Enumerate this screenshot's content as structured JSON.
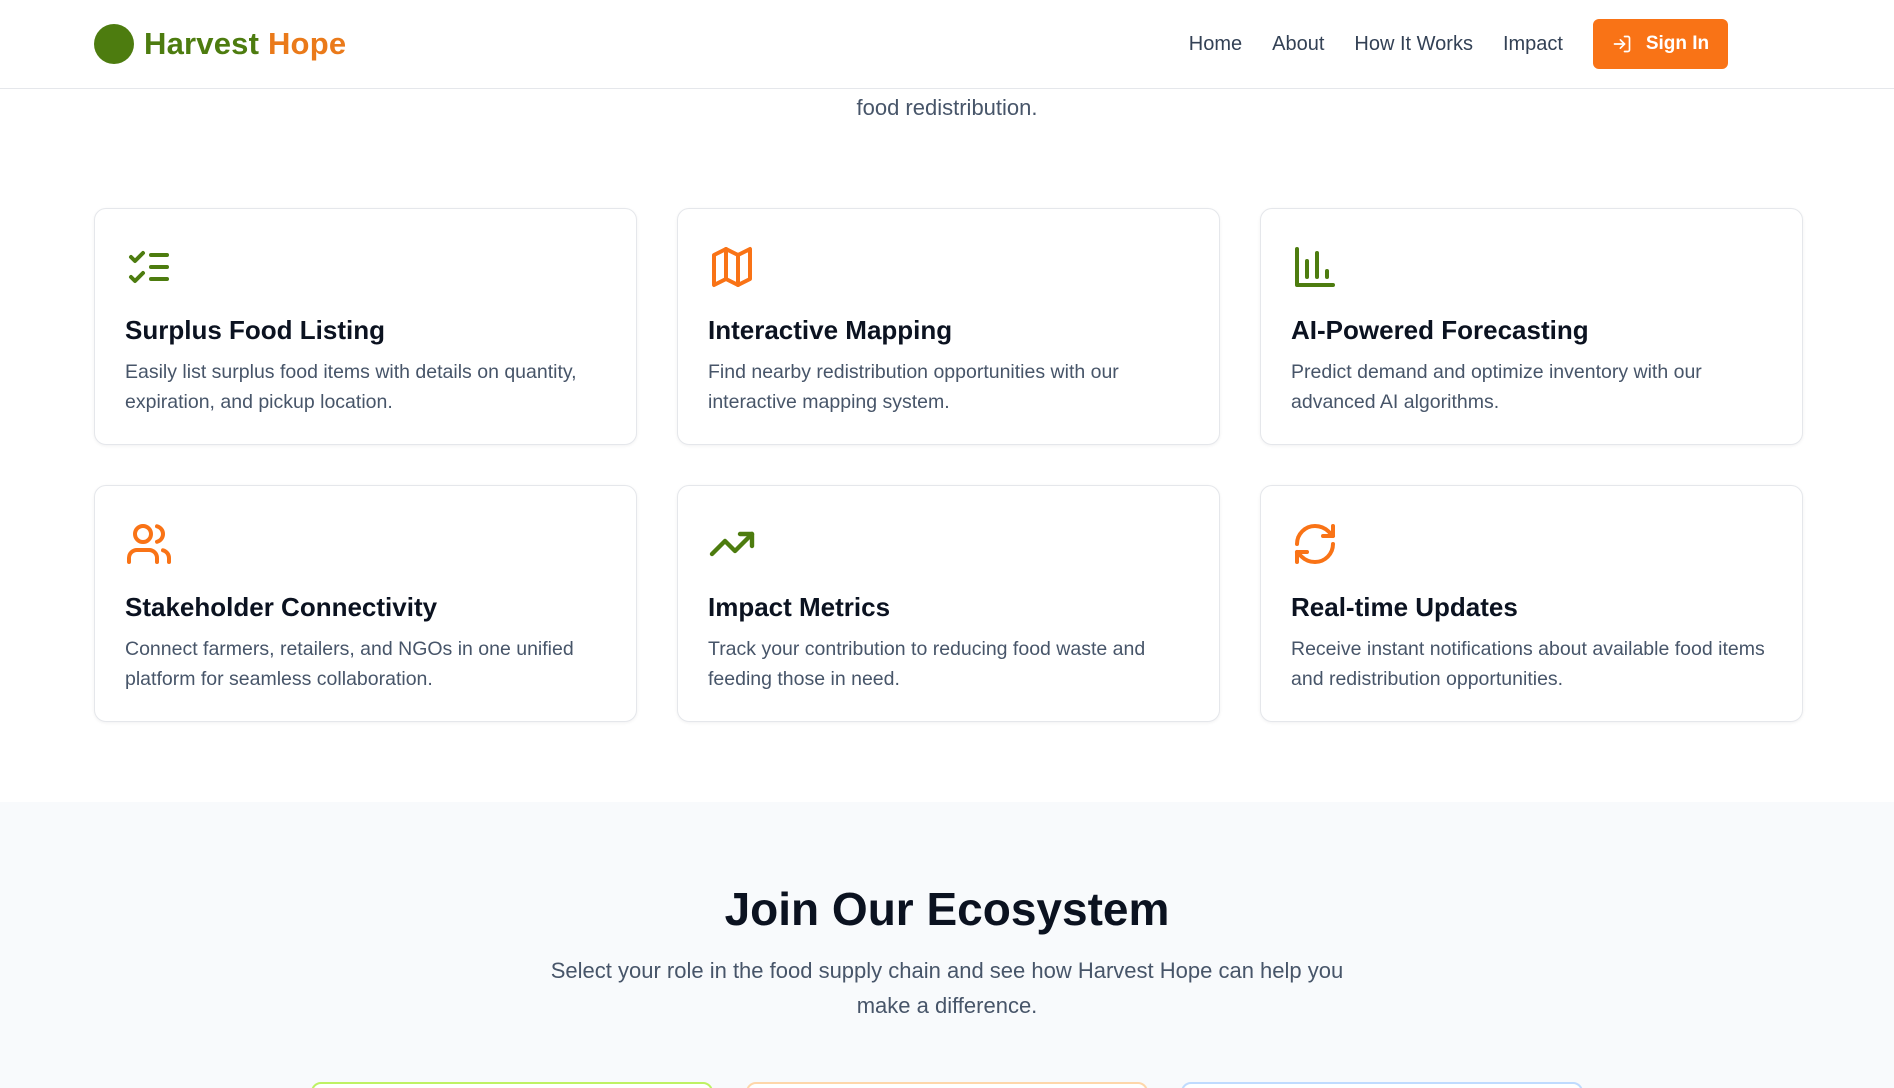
{
  "brand": {
    "word1": "Harvest",
    "word2": "Hope"
  },
  "nav": {
    "links": [
      "Home",
      "About",
      "How It Works",
      "Impact"
    ],
    "signin_label": "Sign In"
  },
  "intro_tail": "food redistribution.",
  "features": [
    {
      "icon": "list-checks-icon",
      "title": "Surplus Food Listing",
      "description": "Easily list surplus food items with details on quantity, expiration, and pickup location."
    },
    {
      "icon": "map-icon",
      "title": "Interactive Mapping",
      "description": "Find nearby redistribution opportunities with our interactive mapping system."
    },
    {
      "icon": "bar-chart-icon",
      "title": "AI-Powered Forecasting",
      "description": "Predict demand and optimize inventory with our advanced AI algorithms."
    },
    {
      "icon": "users-icon",
      "title": "Stakeholder Connectivity",
      "description": "Connect farmers, retailers, and NGOs in one unified platform for seamless collaboration."
    },
    {
      "icon": "trending-up-icon",
      "title": "Impact Metrics",
      "description": "Track your contribution to reducing food waste and feeding those in need."
    },
    {
      "icon": "refresh-icon",
      "title": "Real-time Updates",
      "description": "Receive instant notifications about available food items and redistribution opportunities."
    }
  ],
  "ecosystem": {
    "title": "Join Our Ecosystem",
    "subtitle": "Select your role in the food supply chain and see how Harvest Hope can help you make a difference."
  },
  "colors": {
    "green": "#4d7c0f",
    "orange": "#f97316"
  }
}
